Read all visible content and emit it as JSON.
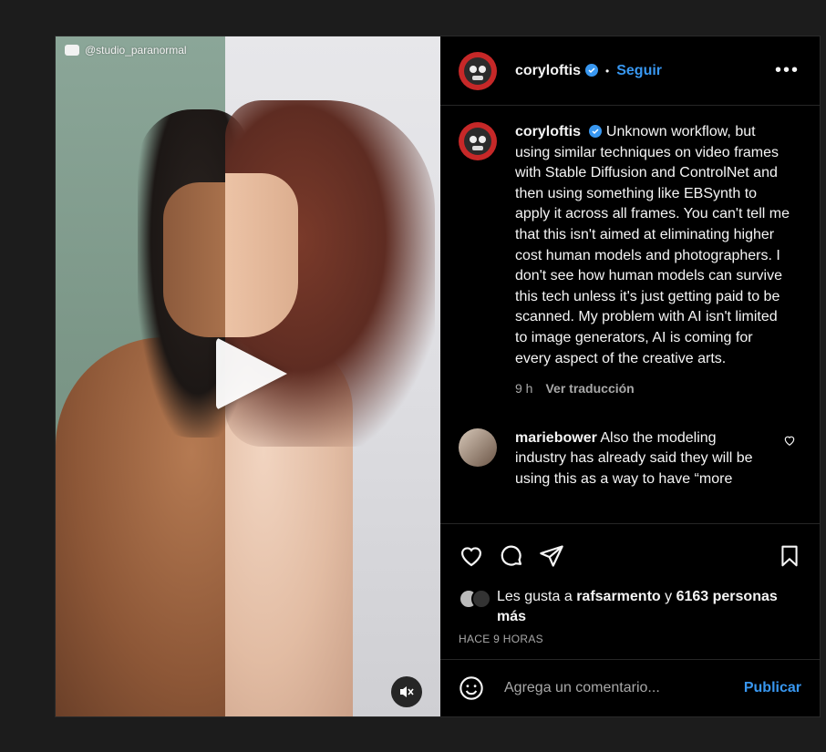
{
  "post": {
    "watermark": "@studio_paranormal",
    "author": "coryloftis",
    "dot": "•",
    "follow_label": "Seguir",
    "more_label": "•••"
  },
  "caption": {
    "username": "coryloftis",
    "text": "Unknown workflow, but using similar techniques on video frames with Stable Diffusion and ControlNet and then using something like EBSynth to apply it across all frames. You can't tell me that this isn't aimed at eliminating higher cost human models and photographers. I don't see how human models can survive this tech unless it's just getting paid to be scanned. My problem with AI isn't limited to image generators, AI is coming for every aspect of the creative arts.",
    "time": "9 h",
    "translate_label": "Ver traducción"
  },
  "comments": [
    {
      "username": "mariebower",
      "text": "Also the modeling industry has already said they will be using this as a way to have “more"
    }
  ],
  "likes": {
    "prefix": "Les gusta a",
    "user": "rafsarmento",
    "conj": "y",
    "others": "6163 personas más"
  },
  "time_ago": "HACE 9 HORAS",
  "composer": {
    "placeholder": "Agrega un comentario...",
    "publish_label": "Publicar"
  },
  "icons": {
    "like": "heart-icon",
    "comment": "comment-icon",
    "share": "share-icon",
    "save": "bookmark-icon",
    "emoji": "emoji-icon",
    "mute": "mute-icon",
    "verified": "verified-badge-icon"
  },
  "colors": {
    "accent": "#3897f0",
    "background": "#000000",
    "secondary_text": "#a8a8a8"
  }
}
